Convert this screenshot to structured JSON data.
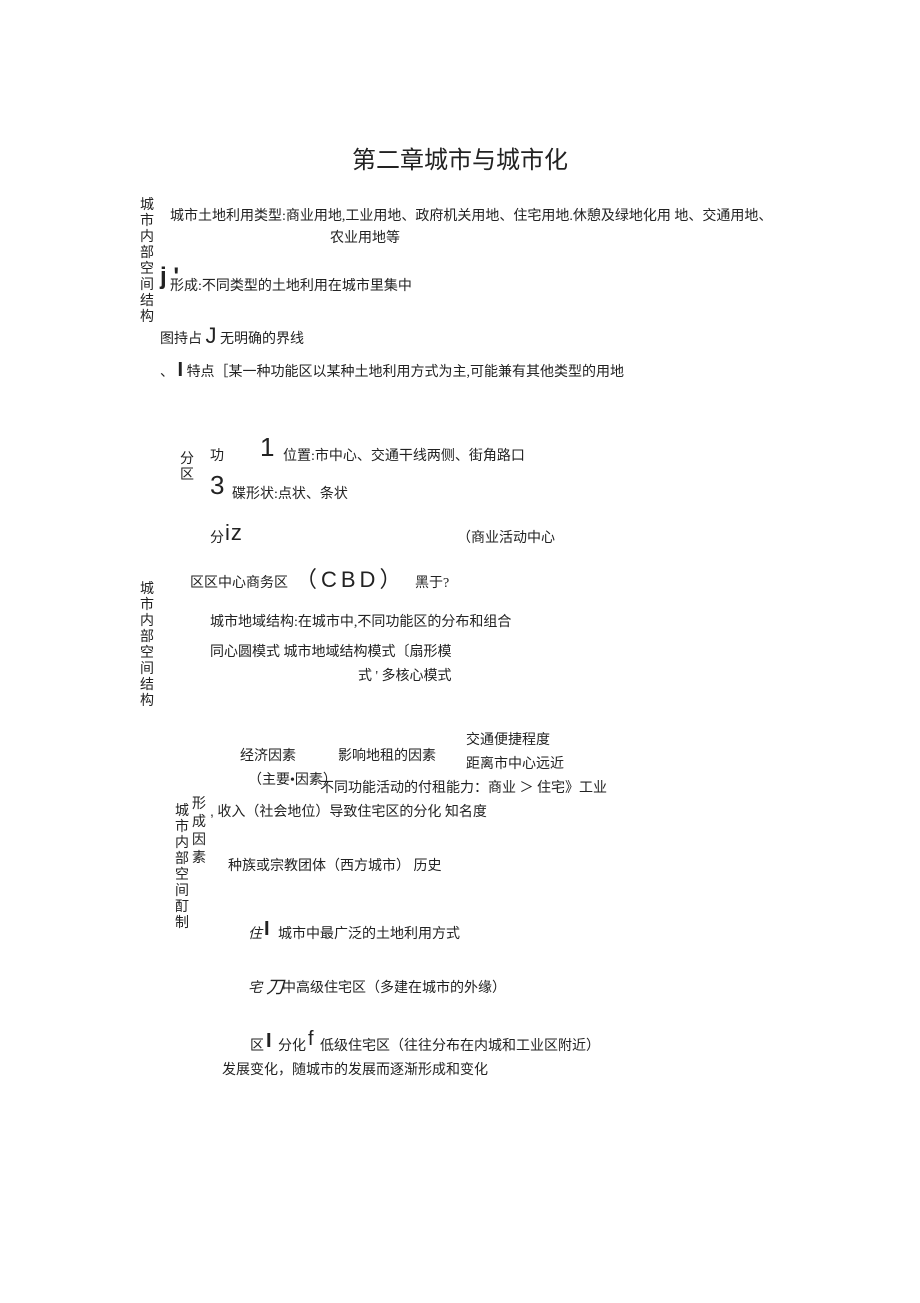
{
  "title": "第二章城市与城市化",
  "vlabels": {
    "v1": "城市内部空间结构",
    "v2": "城市内部空间结构",
    "v3": "城市内部空间酊制",
    "vsub": "形成因素"
  },
  "section1": {
    "landuse1": "城市土地利用类型:商业用地,工业用地、政府机关用地、住宅用地.休憩及绿地化用 地、交通用地、",
    "landuse2": "农业用地等",
    "j_prime": "j '",
    "form": "形成:不同类型的土地利用在城市里集中",
    "tuchi_pre": "图持占",
    "bigJ": "J",
    "tuchi_post": "无明确的界线",
    "tedian_pre": "、",
    "tedian_bar": "I",
    "tedian": "特点［某一种功能区以某种土地利用方式为主,可能兼有其他类型的用地"
  },
  "section2": {
    "gong": "功",
    "one": "1",
    "weizhi": "位置:市中心、交通干线两侧、街角路口",
    "fenqu": "分区",
    "three": "3",
    "dieshape": "碟形状:点状、条状",
    "fen": "分",
    "iz": "iz",
    "shangye": "（商业活动中心",
    "ququ": "区区中心商务区",
    "cbd": "（CBD）",
    "heiyu": "黑于?",
    "chengshidiy": "城市地域结构:在城市中,不同功能区的分布和组合",
    "tongxin": "同心圆模式  城市地域结构模式〔扇形模",
    "shi": "式 ' 多核心模式"
  },
  "section3": {
    "jingji": "经济因素",
    "zhuyao": "（主要•因素）",
    "yingxiang": "影响地租的因素",
    "jiaotong": "交通便捷程度",
    "juli": "距离市中心远近",
    "butong": "不同功能活动的付租能力：商业 ＞ 住宅》工业",
    "shouru": "收入（社会地位）导致住宅区的分化 知名度",
    "zhongzu": "种族或宗教团体（西方城市）  历史"
  },
  "section4": {
    "zhu": "住",
    "zhu_bar": "I",
    "zhu_text": "城市中最广泛的土地利用方式",
    "zhai": "宅",
    "zhai_j": "刀",
    "zhai_text": "中高级住宅区（多建在城市的外缘）",
    "qu": "区",
    "qu_bar": "I",
    "fenhua": "分化",
    "f_letter": "f",
    "diji": "低级住宅区（往往分布在内城和工业区附近）",
    "fazhan": "发展变化，随城市的发展而逐渐形成和变化"
  },
  "punct": {
    "comma": "'",
    "comma2": ","
  }
}
